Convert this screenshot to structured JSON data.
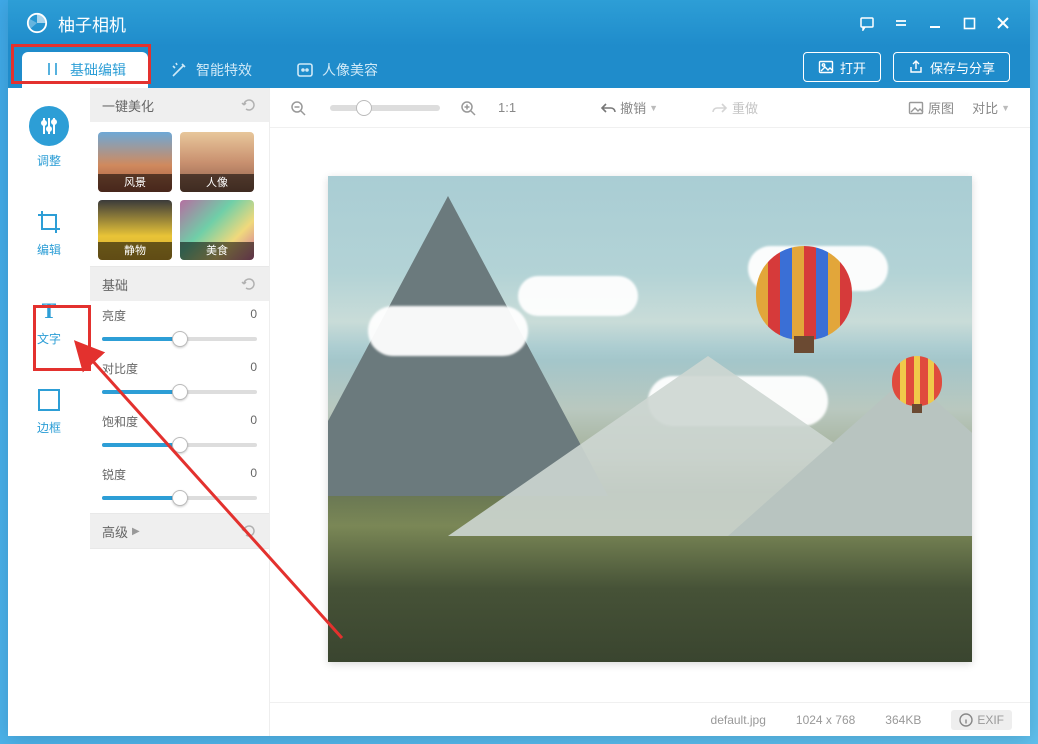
{
  "app_title": "柚子相机",
  "tabs": {
    "basic": "基础编辑",
    "smart": "智能特效",
    "beauty": "人像美容"
  },
  "top_buttons": {
    "open": "打开",
    "save": "保存与分享"
  },
  "side": {
    "adjust": "调整",
    "edit": "编辑",
    "text": "文字",
    "frame": "边框"
  },
  "panel": {
    "beautify": "一键美化",
    "thumbs": {
      "landscape": "风景",
      "portrait": "人像",
      "still": "静物",
      "food": "美食"
    },
    "basic": "基础",
    "brightness": "亮度",
    "contrast": "对比度",
    "saturation": "饱和度",
    "sharpness": "锐度",
    "advanced": "高级",
    "values": {
      "brightness": "0",
      "contrast": "0",
      "saturation": "0",
      "sharpness": "0"
    }
  },
  "toolbar": {
    "ratio": "1:1",
    "undo": "撤销",
    "redo": "重做",
    "original": "原图",
    "compare": "对比"
  },
  "status": {
    "filename": "default.jpg",
    "dims": "1024 x 768",
    "size": "364KB",
    "exif": "EXIF"
  }
}
